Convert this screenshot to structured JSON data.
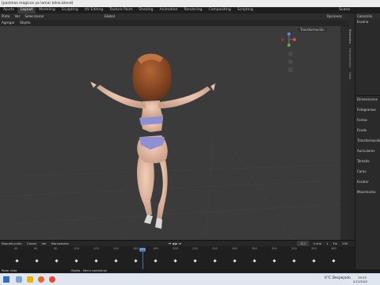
{
  "window": {
    "title": "[pastinos magicos ya lumar blink.blend]"
  },
  "menubar": {
    "items": [
      "Ayuda"
    ],
    "workspaces": [
      "Layout",
      "Modeling",
      "Sculpting",
      "UV Editing",
      "Texture Paint",
      "Shading",
      "Animation",
      "Rendering",
      "Compositing",
      "Scripting"
    ],
    "active_workspace": "Layout",
    "scene": "Scene"
  },
  "toolbar": {
    "mode": "Pinta",
    "menus": [
      "Ver",
      "Seleccionar",
      "Agregar",
      "Objeto"
    ],
    "select": "Global",
    "options": "Opciones"
  },
  "viewport": {
    "n_panel_title": "Transformación",
    "tabs": [
      "Elemento",
      "Herramienta",
      "Vista"
    ]
  },
  "outliner": {
    "title": "Colección",
    "scene": "Escena"
  },
  "properties": {
    "labels": [
      "Dimensiones",
      "Fotogramas",
      "Forma",
      "Fondo",
      "Transformación",
      "Auriculares",
      "Tamaño",
      "Caras",
      "Escalar",
      "Movimiento"
    ]
  },
  "timeline": {
    "menu": [
      "Reproducción",
      "Claves",
      "Ver",
      "Marcadores"
    ],
    "current_frame": "111",
    "start_label": "Inicio",
    "start": "1",
    "end_label": "Fin",
    "end": "250",
    "ticks": [
      "40",
      "60",
      "80",
      "100",
      "120",
      "140",
      "160",
      "180",
      "200",
      "220",
      "240",
      "260",
      "280",
      "300",
      "320",
      "340",
      "360"
    ]
  },
  "statusbar": {
    "items": [
      "Rotar vista",
      "Objeto - Menú contextual"
    ]
  },
  "taskbar": {
    "weather": "6°C Despejado",
    "time": "19:53",
    "date": "2/12/2022"
  },
  "colors": {
    "accent": "#4772b3",
    "viewport_bg": "#3b3b3b"
  }
}
